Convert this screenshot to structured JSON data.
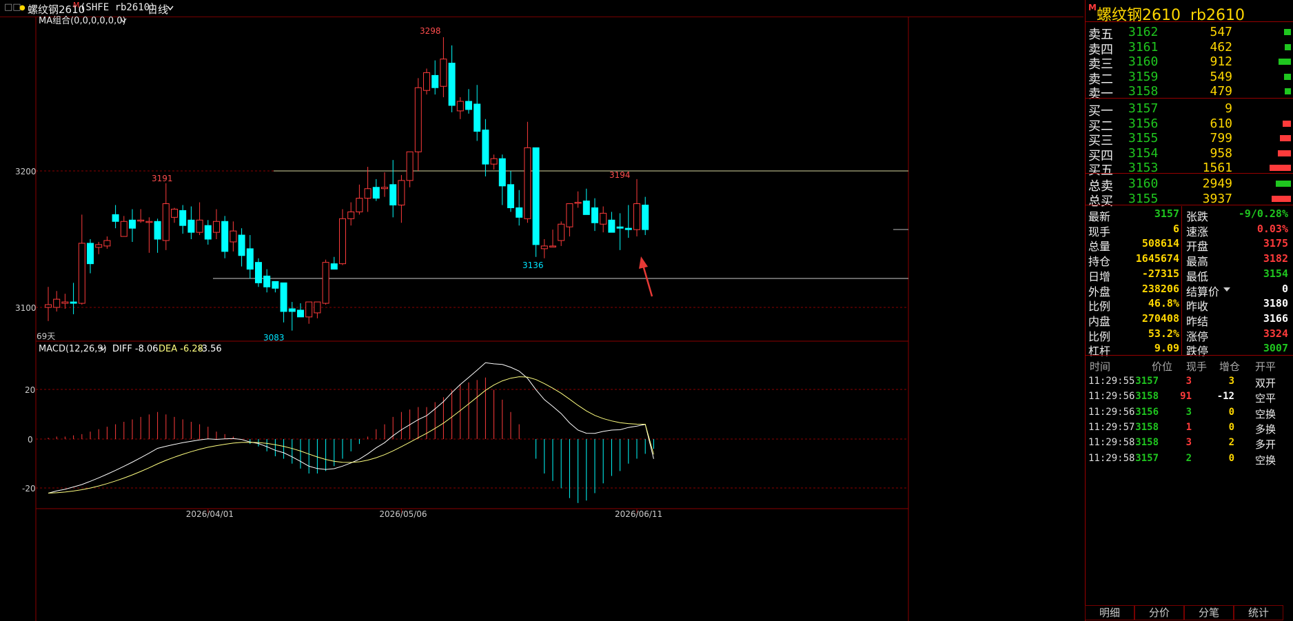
{
  "header": {
    "win_icon": "□□",
    "dot": "●",
    "instrument": "螺纹钢2610",
    "m_badge": "M",
    "exchange": "(SHFE rb2610)",
    "period": "日线",
    "period_icon": "chevron-down-icon"
  },
  "main_chart": {
    "ma_label": "MA组合(0,0,0,0,0,0)",
    "price_ticks": [
      "3200",
      "3100"
    ],
    "high_label": "3298",
    "left_high_label": "3191",
    "right_high_label": "3194",
    "mid_low_label": "3136",
    "low_label": "3083",
    "days_label": "69天"
  },
  "macd": {
    "label": "MACD(12,26,9)",
    "diff": "DIFF -8.06",
    "dea": "DEA -6.28",
    "macd": "-3.56",
    "ticks": [
      "20",
      "0",
      "-20"
    ]
  },
  "dates": [
    "2026/04/01",
    "2026/05/06",
    "2026/06/11"
  ],
  "chart_data": {
    "type": "candlestick",
    "candles": [
      {
        "o": 3100,
        "h": 3115,
        "l": 3090,
        "c": 3102
      },
      {
        "o": 3100,
        "h": 3112,
        "l": 3097,
        "c": 3106
      },
      {
        "o": 3103,
        "h": 3110,
        "l": 3099,
        "c": 3104
      },
      {
        "o": 3104,
        "h": 3118,
        "l": 3095,
        "c": 3103
      },
      {
        "o": 3103,
        "h": 3168,
        "l": 3102,
        "c": 3147
      },
      {
        "o": 3147,
        "h": 3150,
        "l": 3125,
        "c": 3132
      },
      {
        "o": 3144,
        "h": 3148,
        "l": 3139,
        "c": 3146
      },
      {
        "o": 3145,
        "h": 3152,
        "l": 3143,
        "c": 3149
      },
      {
        "o": 3168,
        "h": 3175,
        "l": 3158,
        "c": 3163
      },
      {
        "o": 3152,
        "h": 3167,
        "l": 3152,
        "c": 3163
      },
      {
        "o": 3164,
        "h": 3172,
        "l": 3148,
        "c": 3158
      },
      {
        "o": 3164,
        "h": 3172,
        "l": 3162,
        "c": 3164
      },
      {
        "o": 3163,
        "h": 3166,
        "l": 3140,
        "c": 3163
      },
      {
        "o": 3163,
        "h": 3165,
        "l": 3140,
        "c": 3150
      },
      {
        "o": 3149,
        "h": 3191,
        "l": 3142,
        "c": 3176
      },
      {
        "o": 3166,
        "h": 3173,
        "l": 3162,
        "c": 3172
      },
      {
        "o": 3171,
        "h": 3175,
        "l": 3154,
        "c": 3160
      },
      {
        "o": 3164,
        "h": 3174,
        "l": 3150,
        "c": 3155
      },
      {
        "o": 3155,
        "h": 3177,
        "l": 3153,
        "c": 3164
      },
      {
        "o": 3160,
        "h": 3164,
        "l": 3146,
        "c": 3150
      },
      {
        "o": 3155,
        "h": 3172,
        "l": 3150,
        "c": 3163
      },
      {
        "o": 3163,
        "h": 3167,
        "l": 3136,
        "c": 3141
      },
      {
        "o": 3148,
        "h": 3163,
        "l": 3141,
        "c": 3156
      },
      {
        "o": 3153,
        "h": 3158,
        "l": 3130,
        "c": 3138
      },
      {
        "o": 3143,
        "h": 3153,
        "l": 3121,
        "c": 3128
      },
      {
        "o": 3133,
        "h": 3136,
        "l": 3115,
        "c": 3118
      },
      {
        "o": 3123,
        "h": 3128,
        "l": 3111,
        "c": 3115
      },
      {
        "o": 3119,
        "h": 3119,
        "l": 3111,
        "c": 3114
      },
      {
        "o": 3118,
        "h": 3117,
        "l": 3089,
        "c": 3097
      },
      {
        "o": 3099,
        "h": 3104,
        "l": 3083,
        "c": 3097
      },
      {
        "o": 3098,
        "h": 3103,
        "l": 3094,
        "c": 3093
      },
      {
        "o": 3093,
        "h": 3103,
        "l": 3088,
        "c": 3104
      },
      {
        "o": 3096,
        "h": 3103,
        "l": 3092,
        "c": 3104
      },
      {
        "o": 3103,
        "h": 3135,
        "l": 3102,
        "c": 3133
      },
      {
        "o": 3132,
        "h": 3137,
        "l": 3129,
        "c": 3128
      },
      {
        "o": 3132,
        "h": 3172,
        "l": 3131,
        "c": 3165
      },
      {
        "o": 3165,
        "h": 3177,
        "l": 3160,
        "c": 3170
      },
      {
        "o": 3170,
        "h": 3190,
        "l": 3168,
        "c": 3180
      },
      {
        "o": 3180,
        "h": 3203,
        "l": 3170,
        "c": 3187
      },
      {
        "o": 3188,
        "h": 3194,
        "l": 3178,
        "c": 3180
      },
      {
        "o": 3187,
        "h": 3199,
        "l": 3181,
        "c": 3188
      },
      {
        "o": 3190,
        "h": 3208,
        "l": 3166,
        "c": 3175
      },
      {
        "o": 3175,
        "h": 3197,
        "l": 3162,
        "c": 3193
      },
      {
        "o": 3193,
        "h": 3208,
        "l": 3188,
        "c": 3214
      },
      {
        "o": 3214,
        "h": 3268,
        "l": 3200,
        "c": 3261
      },
      {
        "o": 3259,
        "h": 3275,
        "l": 3256,
        "c": 3272
      },
      {
        "o": 3270,
        "h": 3281,
        "l": 3256,
        "c": 3261
      },
      {
        "o": 3262,
        "h": 3298,
        "l": 3254,
        "c": 3282
      },
      {
        "o": 3279,
        "h": 3292,
        "l": 3243,
        "c": 3248
      },
      {
        "o": 3244,
        "h": 3254,
        "l": 3238,
        "c": 3251
      },
      {
        "o": 3251,
        "h": 3260,
        "l": 3242,
        "c": 3245
      },
      {
        "o": 3249,
        "h": 3263,
        "l": 3222,
        "c": 3229
      },
      {
        "o": 3230,
        "h": 3238,
        "l": 3196,
        "c": 3205
      },
      {
        "o": 3205,
        "h": 3212,
        "l": 3201,
        "c": 3209
      },
      {
        "o": 3209,
        "h": 3212,
        "l": 3175,
        "c": 3189
      },
      {
        "o": 3190,
        "h": 3200,
        "l": 3170,
        "c": 3173
      },
      {
        "o": 3173,
        "h": 3186,
        "l": 3160,
        "c": 3166
      },
      {
        "o": 3165,
        "h": 3236,
        "l": 3162,
        "c": 3217
      },
      {
        "o": 3217,
        "h": 3217,
        "l": 3137,
        "c": 3146
      },
      {
        "o": 3143,
        "h": 3150,
        "l": 3136,
        "c": 3145
      },
      {
        "o": 3145,
        "h": 3157,
        "l": 3145,
        "c": 3145
      },
      {
        "o": 3149,
        "h": 3163,
        "l": 3145,
        "c": 3161
      },
      {
        "o": 3159,
        "h": 3176,
        "l": 3152,
        "c": 3176
      },
      {
        "o": 3177,
        "h": 3185,
        "l": 3173,
        "c": 3177
      },
      {
        "o": 3178,
        "h": 3187,
        "l": 3168,
        "c": 3168
      },
      {
        "o": 3173,
        "h": 3180,
        "l": 3156,
        "c": 3162
      },
      {
        "o": 3161,
        "h": 3174,
        "l": 3155,
        "c": 3169
      },
      {
        "o": 3164,
        "h": 3170,
        "l": 3155,
        "c": 3155
      },
      {
        "o": 3159,
        "h": 3169,
        "l": 3142,
        "c": 3158
      },
      {
        "o": 3158,
        "h": 3175,
        "l": 3151,
        "c": 3157
      },
      {
        "o": 3157,
        "h": 3194,
        "l": 3152,
        "c": 3176
      },
      {
        "o": 3175,
        "h": 3181,
        "l": 3153,
        "c": 3157
      }
    ],
    "y_axis": {
      "ticks": [
        3200,
        3100
      ]
    },
    "x_ticks": [
      {
        "label": "2026/04/01",
        "index": 19
      },
      {
        "label": "2026/05/06",
        "index": 42
      },
      {
        "label": "2026/06/11",
        "index": 70
      }
    ],
    "ref_lines": {
      "dashed": 3200,
      "solid": 3121
    },
    "macd": {
      "ylim": [
        -25,
        35
      ],
      "hist": [
        0.5,
        1,
        1,
        1.5,
        2,
        3,
        4,
        5,
        6,
        7,
        8,
        9,
        10,
        11,
        10,
        9,
        8,
        7,
        6,
        5,
        3,
        2,
        1,
        0,
        -2,
        -3,
        -5,
        -7,
        -8,
        -10,
        -12,
        -14,
        -14,
        -13,
        -11,
        -8,
        -5,
        -2,
        1,
        4,
        6,
        9,
        11,
        12,
        13,
        13,
        15,
        17,
        20,
        22,
        23,
        24,
        25,
        20,
        16,
        11,
        6,
        0,
        -8,
        -14,
        -17,
        -20,
        -24,
        -26,
        -25,
        -22,
        -18,
        -15,
        -13,
        -10,
        -8,
        -6,
        -4
      ]
    }
  },
  "right_panel": {
    "title": "螺纹钢2610  rb2610",
    "m_badge": "M",
    "asks": [
      {
        "label": "卖五",
        "price": "3162",
        "vol": "547",
        "bar": 0.1
      },
      {
        "label": "卖四",
        "price": "3161",
        "vol": "462",
        "bar": 0.09
      },
      {
        "label": "卖三",
        "price": "3160",
        "vol": "912",
        "bar": 0.18
      },
      {
        "label": "卖二",
        "price": "3159",
        "vol": "549",
        "bar": 0.1
      },
      {
        "label": "卖一",
        "price": "3158",
        "vol": "479",
        "bar": 0.09
      }
    ],
    "bids": [
      {
        "label": "买一",
        "price": "3157",
        "vol": "9",
        "bar": 0
      },
      {
        "label": "买二",
        "price": "3156",
        "vol": "610",
        "bar": 0.12
      },
      {
        "label": "买三",
        "price": "3155",
        "vol": "799",
        "bar": 0.16
      },
      {
        "label": "买四",
        "price": "3154",
        "vol": "958",
        "bar": 0.19
      },
      {
        "label": "买五",
        "price": "3153",
        "vol": "1561",
        "bar": 0.31
      }
    ],
    "totals": [
      {
        "label": "总卖",
        "price": "3160",
        "vol": "2949",
        "bar": 0.22,
        "color": "#1fc61f"
      },
      {
        "label": "总买",
        "price": "3155",
        "vol": "3937",
        "bar": 0.28,
        "color": "#ff3b3b"
      }
    ],
    "stats": [
      {
        "l1": "最新",
        "v1": "3157",
        "c1": "#1fc61f",
        "l2": "张跌",
        "v2": "-9/0.28%",
        "c2": "#1fc61f"
      },
      {
        "l1": "现手",
        "v1": "6",
        "c1": "#ffd700",
        "l2": "速涨",
        "v2": "0.03%",
        "c2": "#ff3b3b"
      },
      {
        "l1": "总量",
        "v1": "508614",
        "c1": "#ffd700",
        "l2": "开盘",
        "v2": "3175",
        "c2": "#ff3b3b"
      },
      {
        "l1": "持仓",
        "v1": "1645674",
        "c1": "#ffd700",
        "l2": "最高",
        "v2": "3182",
        "c2": "#ff3b3b"
      },
      {
        "l1": "日增",
        "v1": "-27315",
        "c1": "#ffd700",
        "l2": "最低",
        "v2": "3154",
        "c2": "#1fc61f"
      },
      {
        "l1": "外盘",
        "v1": "238206",
        "c1": "#ffd700",
        "l2": "结算价",
        "v2": "0",
        "c2": "#ffffff"
      },
      {
        "l1": "比例",
        "v1": "46.8%",
        "c1": "#ffd700",
        "l2": "昨收",
        "v2": "3180",
        "c2": "#ffffff"
      },
      {
        "l1": "内盘",
        "v1": "270408",
        "c1": "#ffd700",
        "l2": "昨结",
        "v2": "3166",
        "c2": "#ffffff"
      },
      {
        "l1": "比例",
        "v1": "53.2%",
        "c1": "#ffd700",
        "l2": "涨停",
        "v2": "3324",
        "c2": "#ff3b3b"
      },
      {
        "l1": "杠杆",
        "v1": "9.09",
        "c1": "#ffd700",
        "l2": "跌停",
        "v2": "3007",
        "c2": "#1fc61f"
      }
    ],
    "tick_headers": [
      "时间",
      "价位",
      "现手",
      "增仓",
      "开平"
    ],
    "ticks": [
      {
        "time": "11:29:55",
        "price": "3157",
        "vol": "3",
        "chg": "3",
        "type": "双开",
        "tcolor": "#ffd700",
        "vcolor": "#ff3b3b"
      },
      {
        "time": "11:29:56",
        "price": "3158",
        "vol": "91",
        "chg": "-12",
        "type": "空平",
        "tcolor": "#ffffff",
        "vcolor": "#ff3b3b"
      },
      {
        "time": "11:29:56",
        "price": "3156",
        "vol": "3",
        "chg": "0",
        "type": "空换",
        "tcolor": "#ffd700",
        "vcolor": "#1fc61f"
      },
      {
        "time": "11:29:57",
        "price": "3158",
        "vol": "1",
        "chg": "0",
        "type": "多换",
        "tcolor": "#ffd700",
        "vcolor": "#ff3b3b"
      },
      {
        "time": "11:29:58",
        "price": "3158",
        "vol": "3",
        "chg": "2",
        "type": "多开",
        "tcolor": "#ffd700",
        "vcolor": "#ff3b3b"
      },
      {
        "time": "11:29:58",
        "price": "3157",
        "vol": "2",
        "chg": "0",
        "type": "空换",
        "tcolor": "#ffd700",
        "vcolor": "#1fc61f"
      }
    ],
    "tabs": [
      "明细",
      "分价",
      "分笔",
      "统计"
    ]
  },
  "colors": {
    "up": "#ff3b3b",
    "down": "#00ffff",
    "green": "#1fc61f",
    "yellow": "#ffd700",
    "grid": "#8b0000"
  }
}
